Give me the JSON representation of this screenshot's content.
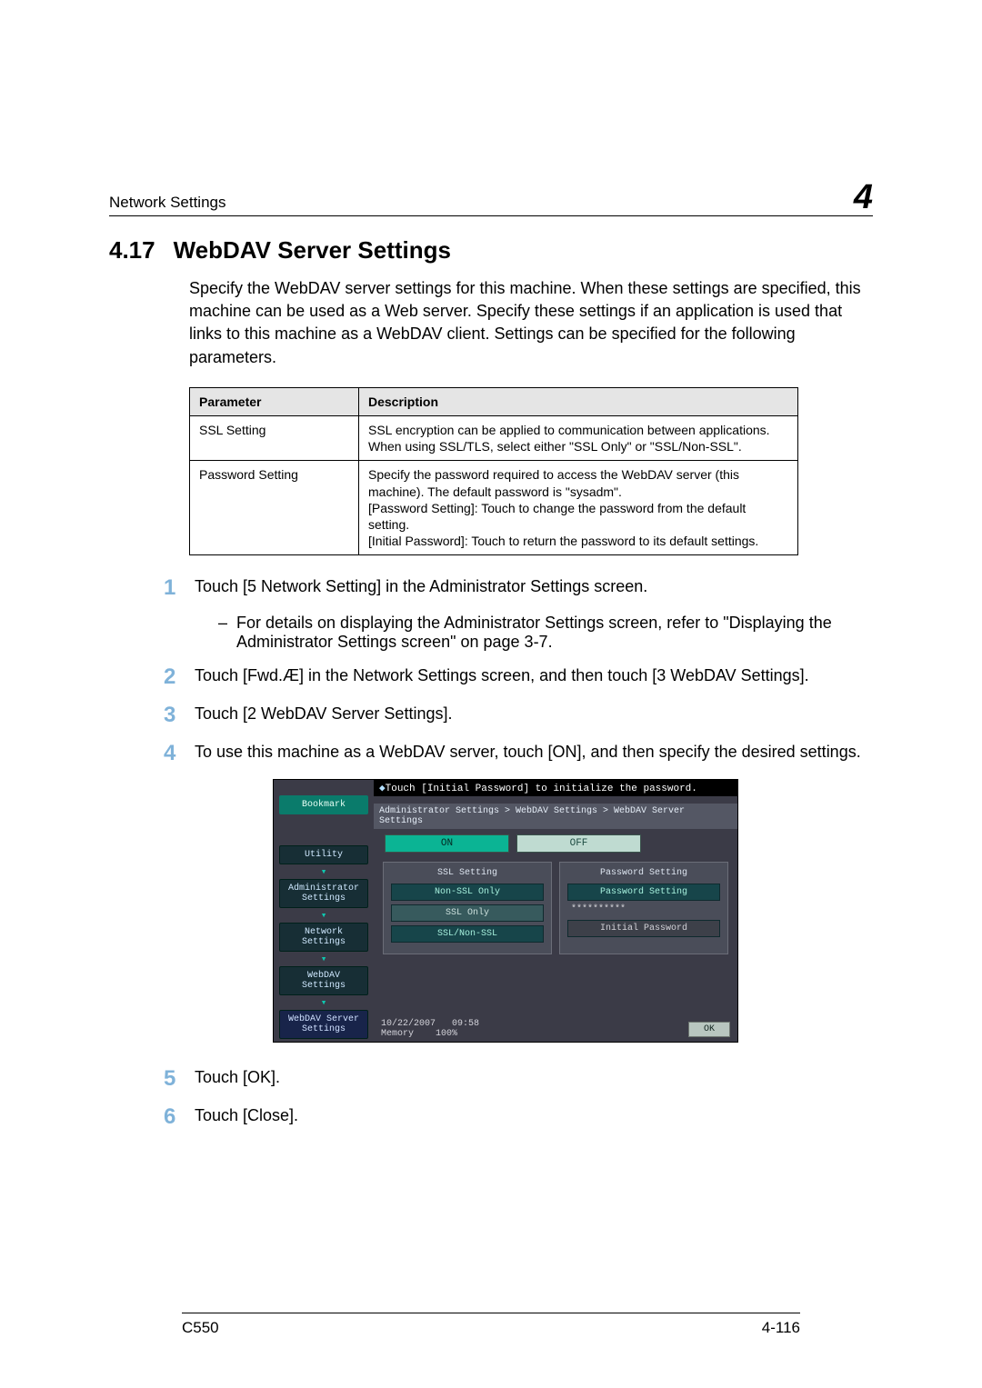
{
  "header": {
    "left": "Network Settings",
    "right": "4"
  },
  "section": {
    "number": "4.17",
    "title": "WebDAV Server Settings"
  },
  "intro": "Specify the WebDAV server settings for this machine. When these settings are specified, this machine can be used as a Web server. Specify these settings if an application is used that links to this machine as a WebDAV client. Settings can be specified for the following parameters.",
  "table": {
    "headers": [
      "Parameter",
      "Description"
    ],
    "rows": [
      {
        "param": "SSL Setting",
        "desc": "SSL encryption can be applied to communication between applications. When using SSL/TLS, select either \"SSL Only\" or \"SSL/Non-SSL\"."
      },
      {
        "param": "Password Setting",
        "desc": "Specify the password required to access the WebDAV server (this machine). The default password is \"sysadm\".\n[Password Setting]: Touch to change the password from the default setting.\n[Initial Password]: Touch to return the password to its default settings."
      }
    ]
  },
  "steps": [
    {
      "n": "1",
      "t": "Touch [5 Network Setting] in the Administrator Settings screen."
    },
    {
      "n": "2",
      "t": "Touch [Fwd.Æ] in the Network Settings screen, and then touch [3 WebDAV Settings]."
    },
    {
      "n": "3",
      "t": "Touch [2 WebDAV Server Settings]."
    },
    {
      "n": "4",
      "t": "To use this machine as a WebDAV server, touch [ON], and then specify the desired settings."
    },
    {
      "n": "5",
      "t": "Touch [OK]."
    },
    {
      "n": "6",
      "t": "Touch [Close]."
    }
  ],
  "substep": "For details on displaying the Administrator Settings screen, refer to \"Displaying the Administrator Settings screen\" on page 3-7.",
  "panel": {
    "hint_prefix": "◆",
    "hint": "Touch [Initial Password] to initialize the password.",
    "breadcrumb": "Administrator Settings > WebDAV Settings > WebDAV Server Settings",
    "side": {
      "bookmark": "Bookmark",
      "utility": "Utility",
      "admin": "Administrator\nSettings",
      "network": "Network\nSettings",
      "webdav": "WebDAV Settings",
      "webdav_server": "WebDAV Server\nSettings"
    },
    "on": "ON",
    "off": "OFF",
    "ssl": {
      "title": "SSL Setting",
      "opt1": "Non-SSL Only",
      "opt2": "SSL Only",
      "opt3": "SSL/Non-SSL"
    },
    "pw": {
      "title": "Password Setting",
      "btn_set": "Password Setting",
      "dots": "**********",
      "btn_init": "Initial Password"
    },
    "footer": {
      "date": "10/22/2007",
      "time": "09:58",
      "mem_label": "Memory",
      "mem_val": "100%",
      "ok": "OK"
    }
  },
  "footer": {
    "left": "C550",
    "right": "4-116"
  }
}
